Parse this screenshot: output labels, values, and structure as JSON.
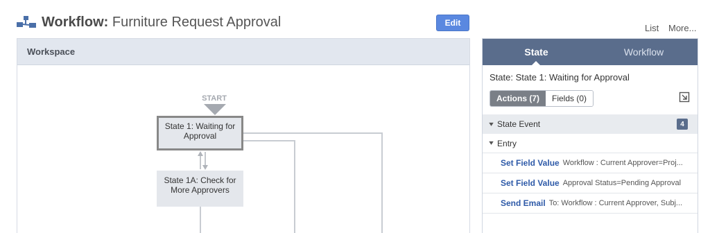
{
  "header": {
    "title_prefix": "Workflow:",
    "title_name": "Furniture Request Approval",
    "edit_label": "Edit",
    "list_label": "List",
    "more_label": "More..."
  },
  "workspace": {
    "title": "Workspace",
    "start_label": "START",
    "states": [
      {
        "label": "State 1: Waiting for Approval"
      },
      {
        "label": "State 1A: Check for More Approvers"
      }
    ]
  },
  "panel": {
    "tabs": [
      {
        "label": "State"
      },
      {
        "label": "Workflow"
      }
    ],
    "state_line": "State: State 1: Waiting for Approval",
    "actions_label": "Actions (7)",
    "fields_label": "Fields (0)",
    "state_event_label": "State Event",
    "state_event_count": "4",
    "entry_label": "Entry",
    "actions": [
      {
        "name": "Set Field Value",
        "detail": "Workflow : Current Approver=Proj..."
      },
      {
        "name": "Set Field Value",
        "detail": "Approval Status=Pending Approval"
      },
      {
        "name": "Send Email",
        "detail": "To: Workflow : Current Approver, Subj..."
      }
    ]
  }
}
